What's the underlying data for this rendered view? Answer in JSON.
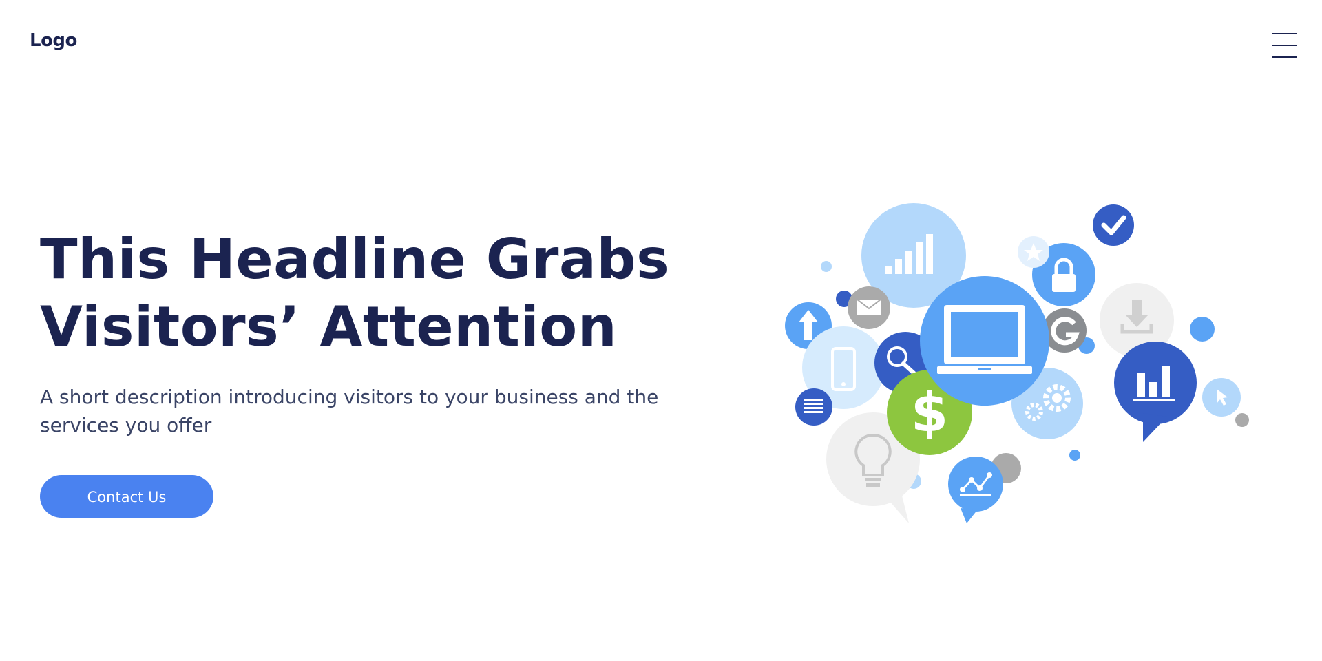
{
  "header": {
    "logo_text": "Logo",
    "menu_icon": "hamburger-menu-icon"
  },
  "hero": {
    "headline_line1": "This Headline Grabs",
    "headline_line2": "Visitors’ Attention",
    "description": "A short description introducing visitors to your business and the services you offer",
    "cta_label": "Contact Us"
  },
  "illustration": {
    "icons": [
      "signal-bars-icon",
      "laptop-icon",
      "dollar-icon",
      "search-icon",
      "mail-icon",
      "smartphone-icon",
      "upload-arrow-icon",
      "document-icon",
      "lightbulb-icon",
      "line-chart-icon",
      "gears-icon",
      "google-g-icon",
      "lock-icon",
      "star-icon",
      "checkmark-icon",
      "download-icon",
      "bar-chart-icon",
      "cursor-icon"
    ]
  },
  "colors": {
    "brand_dark": "#1b2350",
    "accent_blue": "#4a82f0",
    "bubble_light": "#b3d8fb",
    "bubble_mid": "#5aa3f5",
    "bubble_dark": "#355dc4",
    "bubble_green": "#8dc63f",
    "bubble_gray": "#f0f0f0"
  }
}
